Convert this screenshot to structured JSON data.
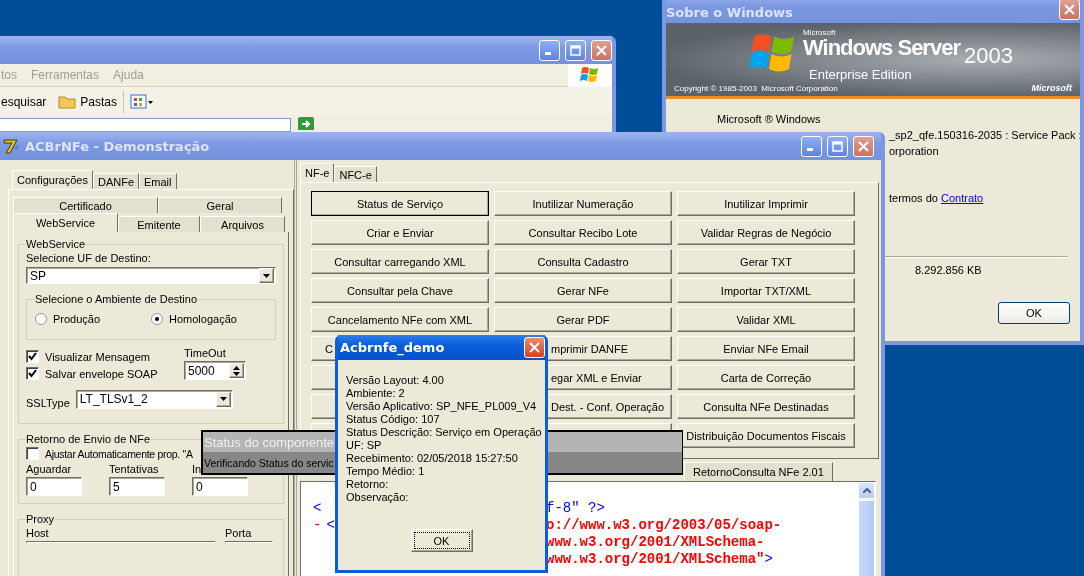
{
  "explorer_window": {
    "menu": [
      {
        "label": "tos"
      },
      {
        "label": "Ferramentas"
      },
      {
        "label": "Ajuda"
      }
    ],
    "toolbar": [
      {
        "kind": "text",
        "label": "esquisar"
      },
      {
        "kind": "folder",
        "label": "Pastas"
      },
      {
        "kind": "views"
      }
    ]
  },
  "about_window": {
    "title": "Sobre o Windows",
    "banner": {
      "maker": "Microsoft",
      "product": "Windows Server",
      "version": "2003",
      "edition": "Enterprise Edition",
      "copyright": "Copyright © 1985-2003  Microsoft Corporation",
      "logo": "Microsoft"
    },
    "lines": [
      "Microsoft ® Windows",
      "_sp2_qfe.150316-2035 : Service Pack :",
      "orporation"
    ],
    "license": {
      "text": "termos do",
      "link": "Contrato"
    },
    "memory": "8.292.856 KB",
    "ok": "OK"
  },
  "main_window": {
    "title": "ACBrNFe - Demonstração",
    "config_tabs": [
      {
        "label": "Configurações",
        "selected": true
      },
      {
        "label": "DANFe",
        "selected": false
      },
      {
        "label": "Email",
        "selected": false
      }
    ],
    "sub_tabs_back": [
      {
        "label": "Certificado",
        "selected": false
      },
      {
        "label": "Geral",
        "selected": false
      }
    ],
    "sub_tabs_front": [
      {
        "label": "WebService",
        "selected": true
      },
      {
        "label": "Emitente",
        "selected": false
      },
      {
        "label": "Arquivos",
        "selected": false
      }
    ],
    "webservice": {
      "legend": "WebService",
      "uf_label": "Selecione UF de Destino:",
      "uf": "SP",
      "ambiente_legend": "Selecione o Ambiente de Destino",
      "ambientes": [
        {
          "label": "Produção",
          "selected": false
        },
        {
          "label": "Homologação",
          "selected": true
        }
      ],
      "options": [
        {
          "label": "Visualizar Mensagem",
          "checked": true
        },
        {
          "label": "Salvar envelope SOAP",
          "checked": true
        }
      ],
      "timeout_label": "TimeOut",
      "timeout": "5000",
      "ssl_label": "SSLType",
      "ssl": "LT_TLSv1_2"
    },
    "retorno": {
      "legend": "Retorno de Envio de NFe",
      "auto": {
        "label": "Ajustar Automaticamente prop. \"A",
        "checked": false
      },
      "fields": [
        {
          "label": "Aguardar",
          "value": "0"
        },
        {
          "label": "Tentativas",
          "value": "5"
        },
        {
          "label": "In",
          "value": "0"
        }
      ]
    },
    "proxy": {
      "legend": "Proxy",
      "host_label": "Host",
      "port_label": "Porta"
    },
    "nfe_tabs": [
      {
        "label": "NF-e",
        "selected": true
      },
      {
        "label": "NFC-e",
        "selected": false
      }
    ],
    "buttons": [
      {
        "kind": "whole",
        "label": "Status de Serviço",
        "focused": true
      },
      {
        "kind": "whole",
        "label": "Inutilizar Numeração",
        "focused": false
      },
      {
        "kind": "whole",
        "label": "Inutilizar Imprimir",
        "focused": false
      },
      {
        "kind": "whole",
        "label": "Criar e Enviar",
        "focused": false
      },
      {
        "kind": "whole",
        "label": "Consultar Recibo Lote",
        "focused": false
      },
      {
        "kind": "whole",
        "label": "Validar Regras de Negócio",
        "focused": false
      },
      {
        "kind": "whole",
        "label": "Consultar carregando XML",
        "focused": false
      },
      {
        "kind": "whole",
        "label": "Consulta Cadastro",
        "focused": false
      },
      {
        "kind": "whole",
        "label": "Gerar TXT",
        "focused": false
      },
      {
        "kind": "whole",
        "label": "Consultar pela Chave",
        "focused": false
      },
      {
        "kind": "whole",
        "label": "Gerar NFe",
        "focused": false
      },
      {
        "kind": "whole",
        "label": "Importar TXT/XML",
        "focused": false
      },
      {
        "kind": "whole",
        "label": "Cancelamento NFe com XML",
        "focused": false
      },
      {
        "kind": "whole",
        "label": "Gerar PDF",
        "focused": false
      },
      {
        "kind": "whole",
        "label": "Validar XML",
        "focused": false
      },
      {
        "kind": "head",
        "label": "C",
        "focused": false
      },
      {
        "kind": "tail",
        "label": "mprimir DANFE",
        "focused": false
      },
      {
        "kind": "whole",
        "label": "Enviar NFe Email",
        "focused": false
      },
      {
        "kind": "whole",
        "focused": false
      },
      {
        "kind": "tail",
        "label": "egar XML e Enviar",
        "focused": false
      },
      {
        "kind": "whole",
        "label": "Carta de Correção",
        "focused": false
      },
      {
        "kind": "whole",
        "focused": false
      },
      {
        "kind": "tail",
        "label": "Dest. - Conf. Operação",
        "focused": false
      },
      {
        "kind": "whole",
        "label": "Consulta NFe Destinadas",
        "focused": false
      },
      {
        "kind": "whole"
      },
      {
        "kind": "whole"
      },
      {
        "kind": "whole",
        "label": "Distribuição Documentos Fiscais",
        "focused": false
      }
    ],
    "result_tabs": [
      {
        "label": "RetornoConsulta NFe 2.01",
        "selected": false
      }
    ],
    "xml": [
      {
        "left": [
          {
            "kind": "markup",
            "text": "<"
          }
        ],
        "right": [
          {
            "kind": "markup",
            "text": "f-8\" ?>"
          }
        ]
      },
      {
        "left": [
          {
            "kind": "toggle",
            "text": "-"
          },
          {
            "kind": "markup",
            "text": "<"
          }
        ],
        "right": [
          {
            "kind": "value",
            "text": "o://www.w3.org/2003/05/soap-"
          }
        ]
      },
      {
        "right": [
          {
            "kind": "value",
            "text": "www.w3.org/2001/XMLSchema-"
          }
        ]
      },
      {
        "right": [
          {
            "kind": "value",
            "text": "www.w3.org/2001/XMLSchema\""
          },
          {
            "kind": "markup",
            "text": ">"
          }
        ]
      }
    ]
  },
  "status_panel": {
    "title": "Status do componente",
    "message": "Verificando Status do servic"
  },
  "dialog": {
    "title": "Acbrnfe_demo",
    "lines": [
      "Versão Layout: 4.00",
      "Ambiente: 2",
      "Versão Aplicativo: SP_NFE_PL009_V4",
      "Status Código: 107",
      "Status Descrição: Serviço em Operação",
      "UF: SP",
      "Recebimento: 02/05/2018 15:27:50",
      "Tempo Médio: 1",
      "Retorno:",
      "Observação:"
    ],
    "ok": "OK"
  }
}
